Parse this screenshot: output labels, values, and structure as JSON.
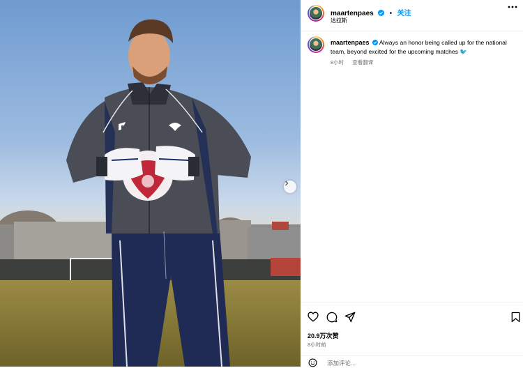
{
  "post": {
    "photo_alt": "Goalkeeper holding ball on field",
    "next_glyph": "›"
  },
  "header": {
    "username": "maartenpaes",
    "follow_label": "关注",
    "dot": "•",
    "location": "达拉斯"
  },
  "caption": {
    "username": "maartenpaes",
    "text": "Always an honor being called up for the national team, beyond excited for the upcoming matches",
    "emoji": "🐦",
    "time_ago": "8小时",
    "translate_label": "查看翻译"
  },
  "actions": {
    "likes": "20.9万次赞",
    "time": "8小时前"
  },
  "comment": {
    "placeholder": "添加评论..."
  },
  "colors": {
    "accent": "#0095f6",
    "verified": "#0095f6",
    "muted": "#737373"
  }
}
